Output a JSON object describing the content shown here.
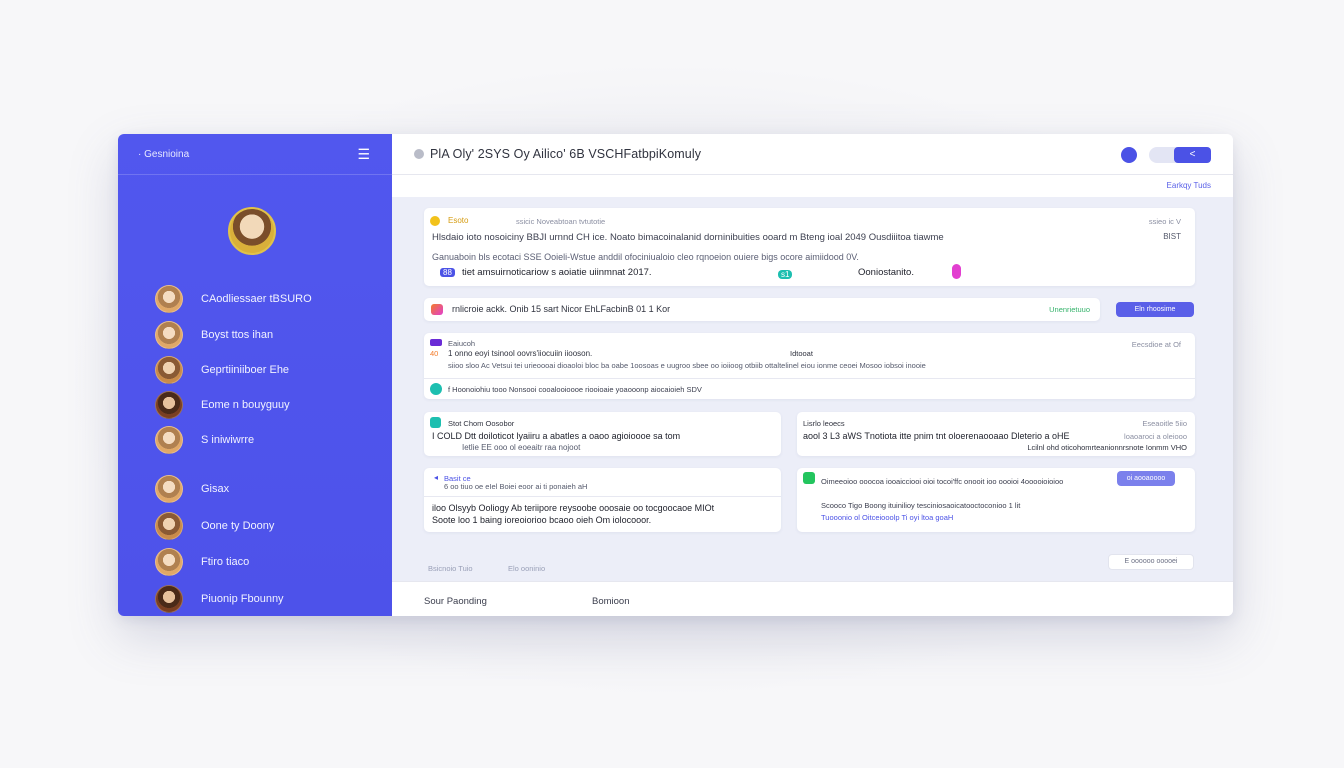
{
  "colors": {
    "accent": "#4d52ea",
    "sidebar_bg": "#5157ee",
    "main_bg": "#eceef8",
    "yellow": "#f2c21b",
    "teal": "#1dbfb0",
    "green": "#23c55e",
    "magenta": "#e23fd0",
    "purple": "#6a2bd6",
    "orange": "#f37b2a"
  },
  "sidebar": {
    "title": "· Gesnioina",
    "menu_icon": "menu-icon",
    "contacts": [
      {
        "name": "CAodliessaer tBSURO"
      },
      {
        "name": "Boyst ttos ihan"
      },
      {
        "name": "Geprtiiniiboer Ehe"
      },
      {
        "name": "Eome n bouyguuy"
      },
      {
        "name": "S iniwiwrre"
      },
      {
        "name": "Gisax"
      },
      {
        "name": "Oone ty Doony"
      },
      {
        "name": "Ftiro tiaco"
      },
      {
        "name": "Piuonip Fbounny"
      }
    ]
  },
  "header": {
    "title": "PlA Oly' 2SYS  Oy  Ailico' 6B VSCHFatbpiKomuly",
    "toggle_label": "<",
    "sublink": "Earkqy  Tuds"
  },
  "card1": {
    "tag": "Esoto",
    "meta": "ssicic Noveabtoan tvtutotie",
    "time": "ssieo  ic V",
    "line1": "Hlsdaio ioto nosoiciny  BBJI   urnnd CH ice. Noato bimacoinalanid dorninibuities ooard m  Bteng  ioal 2049 Ousdiiitoa tiawme",
    "line1_right": "BIST",
    "line2": "Ganuaboin  bls ecotaci SSE  Ooieli-Wstue anddil  ofociniualoio cleo rqnoeion ouiere bigs ocore aimiidood 0V.",
    "line3_badge": "88",
    "line3": "tiet amsuirnoticariow s aoiatie uiinmnat 2017.",
    "mid_badge": "s1",
    "right_text": "Ooniostanito."
  },
  "banner": {
    "text": "rnlicroie ackk.   Onib 15 sart  Nicor EhLFacbinB 01 1 Kor",
    "status": "Unenrietuuo",
    "button": "Eln rhoosime"
  },
  "card2": {
    "title": "Eaiucoh",
    "time": "Eecsdioe at Of",
    "line1_badge": "40",
    "line1": "1 onno eoyi tsinool oovrs'iiocuiin iiooson.",
    "line1_tag": "Idtooat",
    "line2": "siioo sloo Ac  Vetsui  tei urieoooai  dioaoloi  bloc ba oabe  1oosoas e uugroo  sbee oo  ioiioog otbiib ottaltelinel eiou ionme  ceoei  Mosoo iobsoi inooie",
    "line3_icon": "pin-icon",
    "line3": "f Hoonoiohiu tooo   Nonsooi  cooalooioooe   riooioaie  yoaooonp aiocaioieh SDV"
  },
  "card3": {
    "title": "Stot Chom Oosobor",
    "line1": "I COLD Dtt doiloticot lyaiiru a  abatles  a oaoo agioioooe  sa tom",
    "line2": "Ietlie  EE ooo ol eoeaitr raa nojoot"
  },
  "card4": {
    "title": "Lisrlo leoecs",
    "meta": "Eseaoitle  5iio",
    "line1": "aool 3 L3  aWS  Tnotiota itte  pnim tnt oloerenaooaao  Dleterio a  oHE",
    "meta2": "loaoaroci a oleiooo",
    "line2": "Lcilnl ohd oticohomrteanionnrsnote Ionmm  VHO"
  },
  "card5": {
    "icon": "arrow-left-icon",
    "title": "Basit ce",
    "meta": "6 oo tiuo oe eIel  Boiei  eoor ai ti ponaieh aH",
    "line1": "iloo  Olsyyb  Ooliogy Ab  teriipore  reysoobe ooosaie  oo  tocgoocaoe  MIOt",
    "line2": "Soote  loo 1  baing  ioreoiorioo bcaoo oieh  Om  iolocooor."
  },
  "card6": {
    "title": "Oimeeoioo ooocoa  iooaicciooi  oioi tocoi'ffc onooit ioo oooioi 4ooooioioioo",
    "button": "oi  aooaoooo",
    "line1": "Scooco  Tigo  Boong  ituinilioy tesciniosaoicatooctoconioo 1  lit",
    "line2": "Tuooonio ol  Oitceiooolp Ti oyi ltoa goaH"
  },
  "bottom_tags": {
    "left1": "Bsicnoio Tuio",
    "left2": "Elo ooninio",
    "right_button": "E  oooooo  ooooei"
  },
  "footer": {
    "left": "Sour  Paonding",
    "middle": "Bomioon"
  }
}
